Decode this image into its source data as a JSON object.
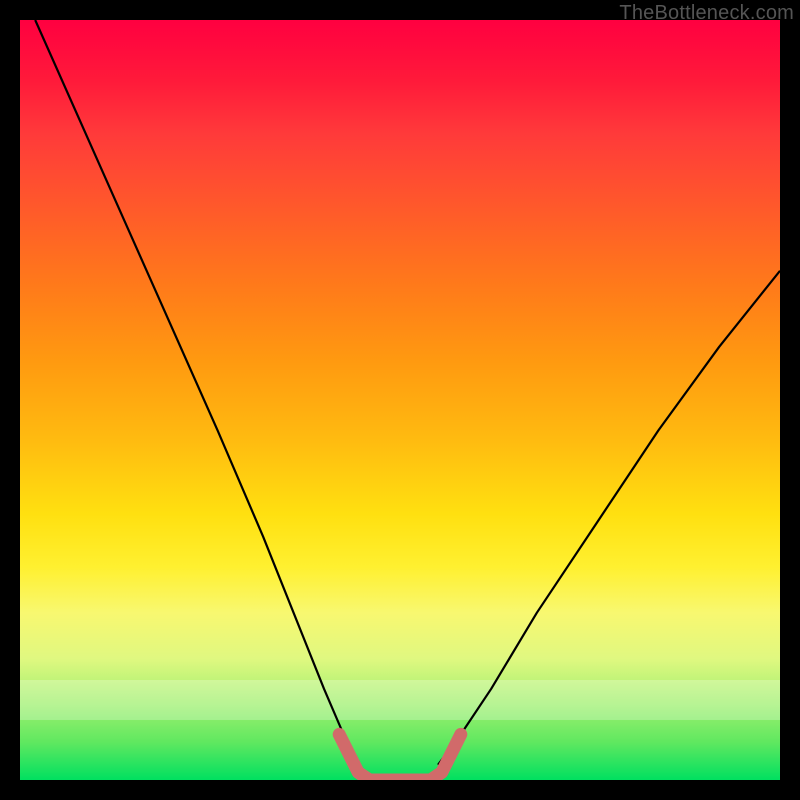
{
  "watermark": "TheBottleneck.com",
  "chart_data": {
    "type": "line",
    "title": "",
    "xlabel": "",
    "ylabel": "",
    "xlim": [
      0,
      100
    ],
    "ylim": [
      0,
      100
    ],
    "grid": false,
    "legend": null,
    "annotations": [],
    "series": [
      {
        "name": "left-curve",
        "color": "#000000",
        "x": [
          2,
          10,
          18,
          26,
          32,
          36,
          40,
          43,
          44.5
        ],
        "values": [
          100,
          82,
          64,
          46,
          32,
          22,
          12,
          5,
          2
        ]
      },
      {
        "name": "right-curve",
        "color": "#000000",
        "x": [
          55,
          58,
          62,
          68,
          76,
          84,
          92,
          100
        ],
        "values": [
          2,
          6,
          12,
          22,
          34,
          46,
          57,
          67
        ]
      },
      {
        "name": "bottom-bracket",
        "color": "#d16a6a",
        "x": [
          42,
          44.5,
          46,
          54,
          55.5,
          58
        ],
        "values": [
          6,
          1,
          0,
          0,
          1,
          6
        ]
      }
    ]
  }
}
